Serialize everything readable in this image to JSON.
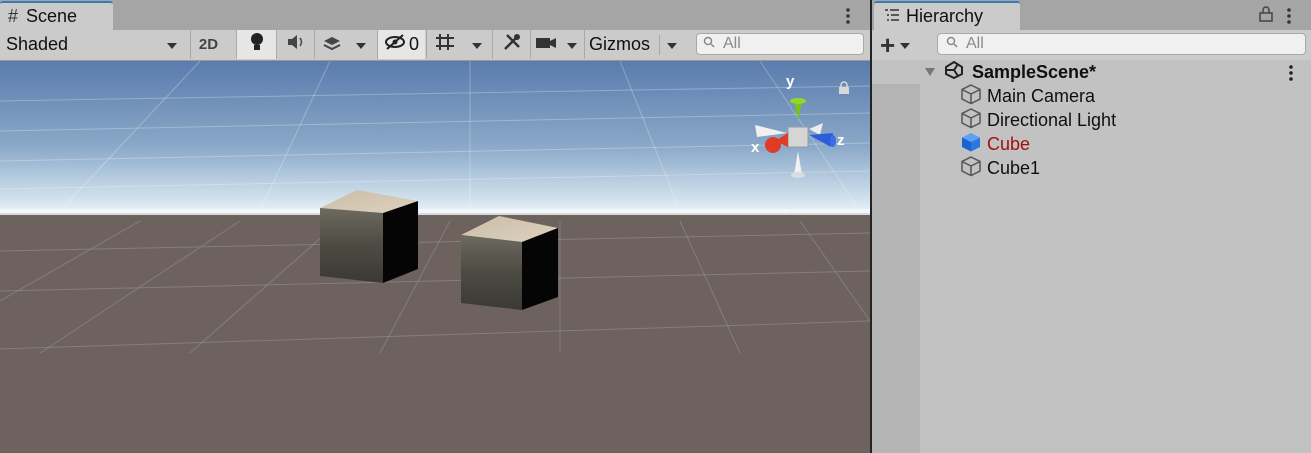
{
  "scene_tab": {
    "label": "Scene"
  },
  "scene_toolbar": {
    "draw_mode": "Shaded",
    "mode_2d": "2D",
    "hidden_count": "0",
    "gizmos": "Gizmos",
    "search_placeholder": "All"
  },
  "viewport": {
    "gizmo_axes": {
      "x": "x",
      "y": "y",
      "z": "z"
    },
    "colors": {
      "sky": "#5b7fb3",
      "horizon": "#d8e6f0",
      "ground": "#6d625d",
      "x_axis": "#e03b24",
      "y_axis": "#78c41c",
      "z_axis": "#2c5ed8"
    }
  },
  "hierarchy_tab": {
    "label": "Hierarchy"
  },
  "hierarchy_toolbar": {
    "add": "+",
    "search_placeholder": "All"
  },
  "hierarchy": {
    "scene_name": "SampleScene*",
    "items": [
      {
        "label": "Main Camera",
        "selected": false
      },
      {
        "label": "Directional Light",
        "selected": false
      },
      {
        "label": "Cube",
        "selected": true,
        "color": "#a01010"
      },
      {
        "label": "Cube1",
        "selected": false
      }
    ]
  }
}
